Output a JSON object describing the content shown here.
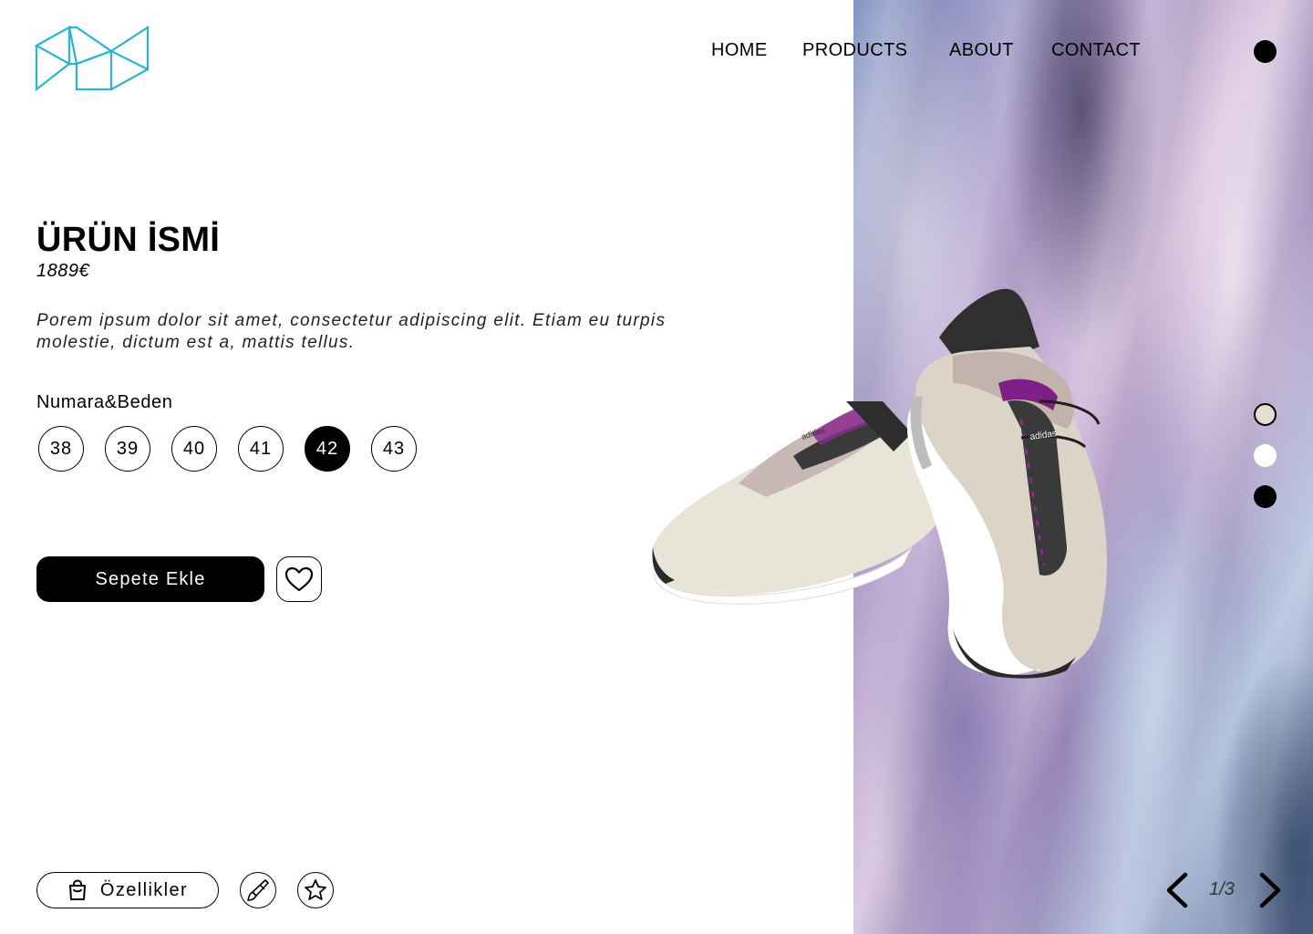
{
  "nav": {
    "home": "HOME",
    "products": "PRODUCTS",
    "about": "ABOUT",
    "contact": "CONTACT"
  },
  "product": {
    "title": "ÜRÜN İSMİ",
    "price": "1889€",
    "description": "Porem ipsum dolor sit amet, consectetur adipiscing elit. Etiam eu turpis molestie, dictum est a, mattis tellus.",
    "image_brand_text": "adidas"
  },
  "sizes": {
    "label": "Numara&Beden",
    "options": [
      "38",
      "39",
      "40",
      "41",
      "42",
      "43"
    ],
    "selected": "42"
  },
  "actions": {
    "add_to_cart": "Sepete Ekle",
    "features": "Özellikler"
  },
  "icons": {
    "logo": "triangle-logo-icon",
    "favorite": "heart-icon",
    "features": "shopping-bag-icon",
    "tool_1": "brush-icon",
    "tool_2": "star-icon",
    "prev": "chevron-left-icon",
    "next": "chevron-right-icon"
  },
  "colors": {
    "logo": "#29b6cc",
    "accent": "#000000",
    "swatches": [
      "#e4ddd0",
      "#ffffff",
      "#000000"
    ]
  },
  "pagination": {
    "current": 1,
    "total": 3,
    "label": "1/3"
  }
}
